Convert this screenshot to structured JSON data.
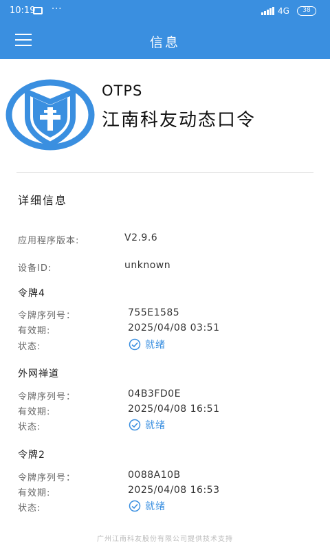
{
  "status_bar": {
    "time": "10:19",
    "dots": "···",
    "network": "4G",
    "battery": "38"
  },
  "header": {
    "title": "信息"
  },
  "app": {
    "name": "OTPS",
    "subtitle": "江南科友动态口令"
  },
  "details": {
    "title": "详细信息",
    "app_version_label": "应用程序版本:",
    "app_version": "V2.9.6",
    "device_id_label": "设备ID:",
    "device_id": "unknown"
  },
  "tokens": [
    {
      "name": "令牌4",
      "serial_label": "令牌序列号：",
      "serial": "755E1585",
      "expiry_label": "有效期:",
      "expiry": "2025/04/08 03:51",
      "status_label": "状态:",
      "status": "就绪"
    },
    {
      "name": "外网禅道",
      "serial_label": "令牌序列号：",
      "serial": "04B3FD0E",
      "expiry_label": "有效期:",
      "expiry": "2025/04/08 16:51",
      "status_label": "状态:",
      "status": "就绪"
    },
    {
      "name": "令牌2",
      "serial_label": "令牌序列号：",
      "serial": "0088A10B",
      "expiry_label": "有效期:",
      "expiry": "2025/04/08 16:53",
      "status_label": "状态:",
      "status": "就绪"
    }
  ],
  "footer": {
    "text": "广州江南科友股份有限公司提供技术支持"
  },
  "colors": {
    "primary": "#3a8fe0",
    "text": "#333333",
    "label": "#666666"
  },
  "icons": {
    "menu": "menu-icon",
    "logo": "shield-logo-icon",
    "status": "check-circle-icon"
  }
}
